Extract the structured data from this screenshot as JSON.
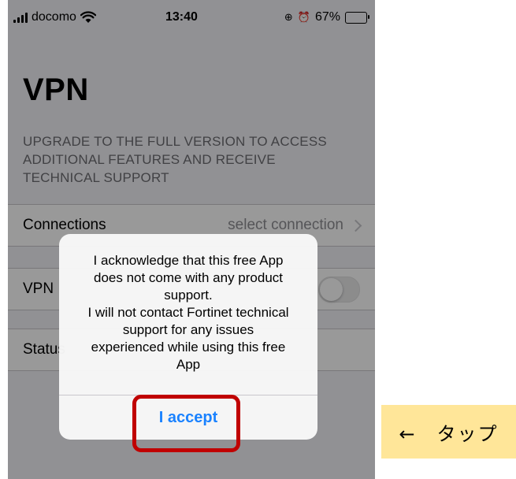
{
  "status_bar": {
    "carrier": "docomo",
    "time": "13:40",
    "battery_percent": "67%",
    "battery_level": 0.67,
    "icons": [
      "signal-icon",
      "wifi-icon",
      "orientation-lock-icon",
      "alarm-icon",
      "battery-icon"
    ]
  },
  "page": {
    "title": "VPN",
    "upgrade_notice": "UPGRADE TO THE FULL VERSION TO ACCESS ADDITIONAL FEATURES AND RECEIVE TECHNICAL SUPPORT"
  },
  "settings": {
    "connections_label": "Connections",
    "connections_value": "select connection",
    "vpn_label": "VPN",
    "vpn_on": false,
    "status_label": "Status"
  },
  "alert": {
    "message_lines": [
      "I acknowledge that this free App",
      "does not come with any product",
      "support.",
      "I will not contact Fortinet technical",
      "support for any issues",
      "experienced while using this free",
      "App"
    ],
    "accept_label": "I accept"
  },
  "callout": {
    "text": "←　タップ",
    "color": "#ffe699",
    "highlight_color": "#c00000"
  },
  "colors": {
    "accent": "#1a82ff",
    "background": "#f2f2f7"
  }
}
